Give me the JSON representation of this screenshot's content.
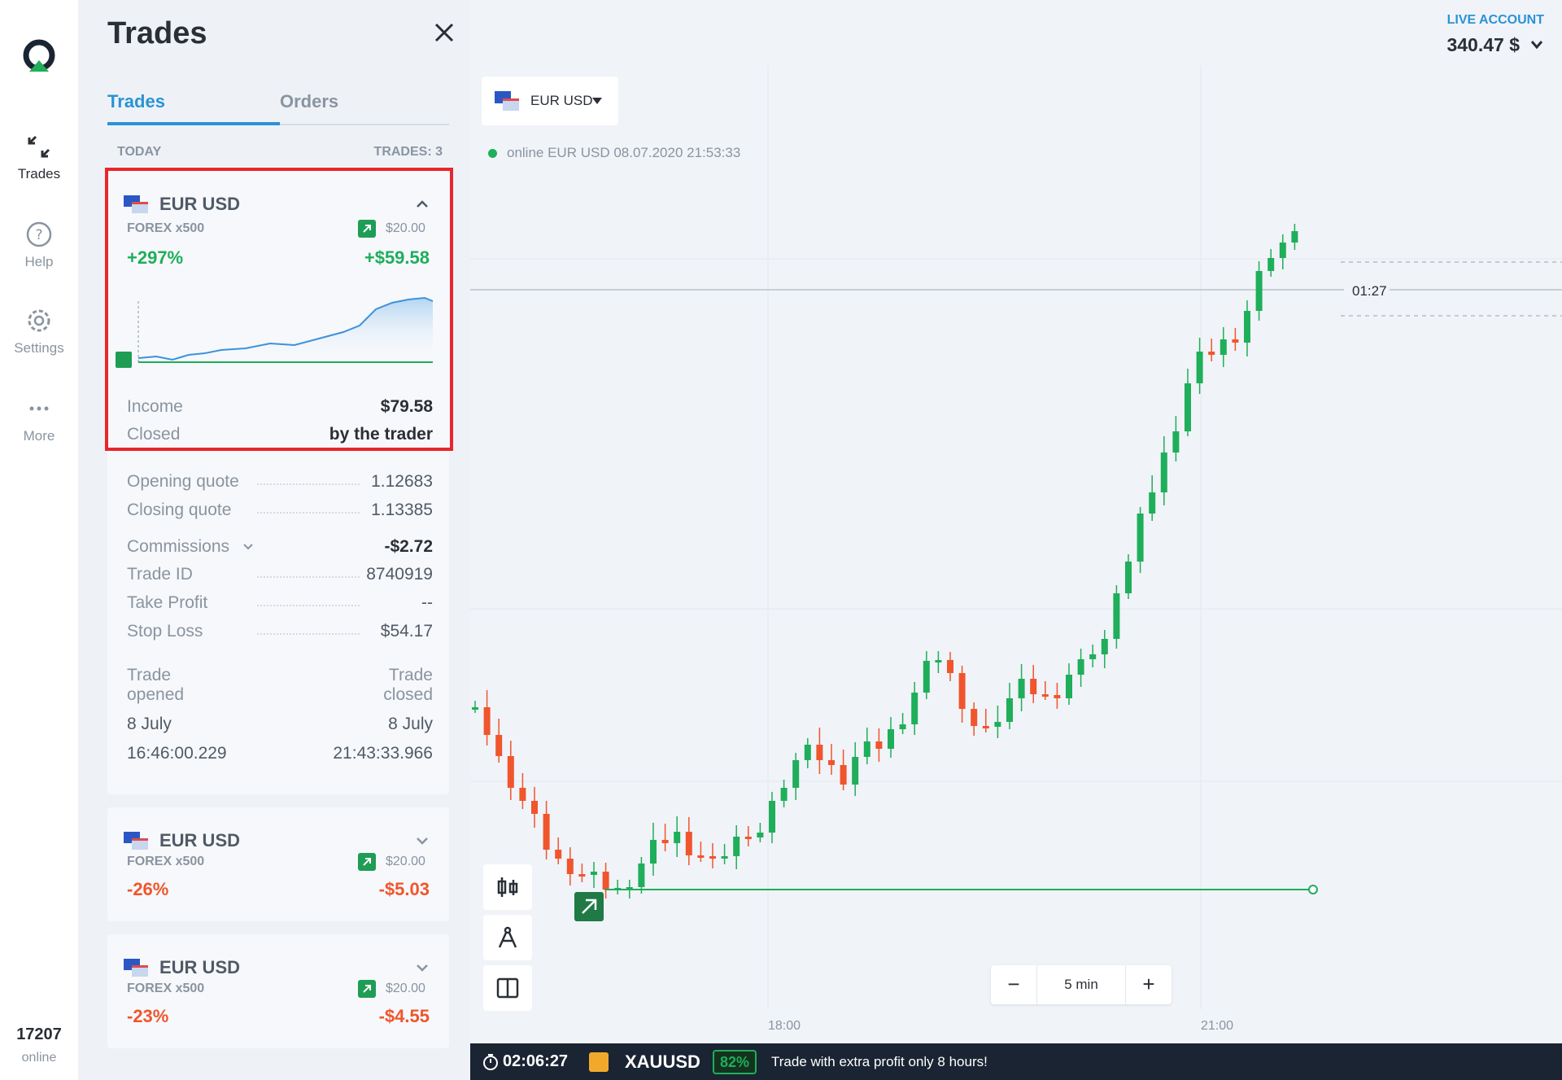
{
  "rail": {
    "items": [
      {
        "label": "Trades",
        "icon": "collapse-arrows-icon"
      },
      {
        "label": "Help",
        "icon": "help-icon"
      },
      {
        "label": "Settings",
        "icon": "gear-icon"
      },
      {
        "label": "More",
        "icon": "more-dots-icon"
      }
    ],
    "online_count": "17207",
    "online_label": "online"
  },
  "panel": {
    "title": "Trades",
    "tabs": [
      {
        "label": "Trades",
        "active": true
      },
      {
        "label": "Orders",
        "active": false
      }
    ],
    "list_header": {
      "left": "TODAY",
      "right": "TRADES: 3"
    }
  },
  "trades": [
    {
      "pair": "EUR USD",
      "sub": "FOREX x500",
      "amount": "$20.00",
      "pct": "+297%",
      "pnl": "+$59.58",
      "income_label": "Income",
      "income": "$79.58",
      "closed_label": "Closed",
      "closed": "by the trader",
      "details": [
        {
          "label": "Opening quote",
          "value": "1.12683"
        },
        {
          "label": "Closing quote",
          "value": "1.13385"
        },
        {
          "label": "Commissions",
          "value": "-$2.72"
        },
        {
          "label": "Trade ID",
          "value": "8740919"
        },
        {
          "label": "Take Profit",
          "value": "--"
        },
        {
          "label": "Stop Loss",
          "value": "$54.17"
        }
      ],
      "opened_label_1": "Trade",
      "opened_label_2": "opened",
      "closed_label_1": "Trade",
      "closed_label_2": "closed",
      "opened_date": "8 July",
      "opened_time": "16:46:00.229",
      "closed_date": "8 July",
      "closed_time": "21:43:33.966"
    },
    {
      "pair": "EUR USD",
      "sub": "FOREX x500",
      "amount": "$20.00",
      "pct": "-26%",
      "pnl": "-$5.03"
    },
    {
      "pair": "EUR USD",
      "sub": "FOREX x500",
      "amount": "$20.00",
      "pct": "-23%",
      "pnl": "-$4.55"
    }
  ],
  "account": {
    "label": "LIVE ACCOUNT",
    "balance": "340.47 $"
  },
  "chart_header": {
    "pair": "EUR USD",
    "status": "online EUR USD  08.07.2020 21:53:33"
  },
  "chart": {
    "countdown": "01:27",
    "zoom_value": "5 min",
    "zoom_minus": "−",
    "zoom_plus": "+",
    "x_ticks": [
      "18:00",
      "21:00"
    ],
    "up_color": "#1fae5a",
    "down_color": "#f0552d"
  },
  "bottom_bar": {
    "timer": "02:06:27",
    "asset": "XAUUSD",
    "pct": "82%",
    "message": "Trade with extra profit only 8 hours!"
  }
}
